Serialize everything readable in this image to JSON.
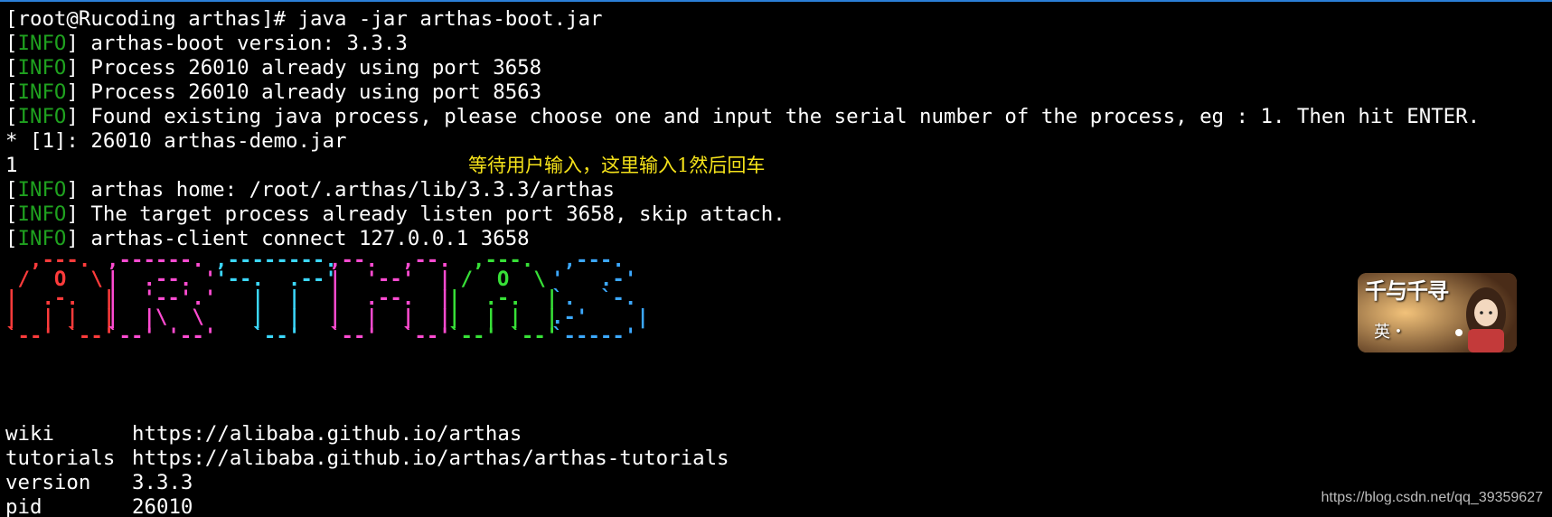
{
  "colors": {
    "background": "#000000",
    "text": "#ffffff",
    "info_level": "#1fa11f",
    "annotation": "#f5e21a",
    "title_border": "#2b7fd8"
  },
  "terminal": {
    "lines": [
      {
        "type": "plain",
        "text": "[root@Rucoding arthas]# java -jar arthas-boot.jar"
      },
      {
        "type": "log",
        "open": "[",
        "level": "INFO",
        "close": "]",
        "msg": " arthas-boot version: 3.3.3"
      },
      {
        "type": "log",
        "open": "[",
        "level": "INFO",
        "close": "]",
        "msg": " Process 26010 already using port 3658"
      },
      {
        "type": "log",
        "open": "[",
        "level": "INFO",
        "close": "]",
        "msg": " Process 26010 already using port 8563"
      },
      {
        "type": "log",
        "open": "[",
        "level": "INFO",
        "close": "]",
        "msg": " Found existing java process, please choose one and input the serial number of the process, eg : 1. Then hit ENTER."
      },
      {
        "type": "plain",
        "text": "* [1]: 26010 arthas-demo.jar"
      },
      {
        "type": "plain",
        "text": "1"
      },
      {
        "type": "log",
        "open": "[",
        "level": "INFO",
        "close": "]",
        "msg": " arthas home: /root/.arthas/lib/3.3.3/arthas"
      },
      {
        "type": "log",
        "open": "[",
        "level": "INFO",
        "close": "]",
        "msg": " The target process already listen port 3658, skip attach."
      },
      {
        "type": "log",
        "open": "[",
        "level": "INFO",
        "close": "]",
        "msg": " arthas-client connect 127.0.0.1 3658"
      }
    ],
    "annotation": "等待用户输入，这里输入1然后回车"
  },
  "banner": {
    "letters": [
      {
        "letter": "A",
        "color": "red",
        "rows": [
          "  ,---.  ",
          " /  O  \\ ",
          "|  .-.  |",
          "|  | |  |",
          "`--' `--'"
        ]
      },
      {
        "letter": "R",
        "color": "magenta",
        "rows": [
          ",------. ",
          "|  .--. '",
          "|  '--'.'",
          "|  |\\  \\ ",
          "`--' '--'"
        ]
      },
      {
        "letter": "T",
        "color": "cyan",
        "rows": [
          ",--------.",
          "'--.  .--'",
          "   |  |   ",
          "   |  |   ",
          "   `--'   "
        ]
      },
      {
        "letter": "H",
        "color": "pink",
        "rows": [
          ",--.  ,--.",
          "|  '--'  |",
          "|  .--.  |",
          "|  |  |  |",
          "`--'  `--'"
        ]
      },
      {
        "letter": "A",
        "color": "green",
        "rows": [
          "  ,---.  ",
          " /  O  \\ ",
          "|  .-.  |",
          "|  | |  |",
          "`--' `--'"
        ]
      },
      {
        "letter": "S",
        "color": "blue",
        "rows": [
          " ,---.  ",
          "'   .-' ",
          "`.  `-. ",
          ".-'    |",
          "`-----' "
        ]
      }
    ]
  },
  "logo": {
    "title": "千与千寻",
    "subtitle": "英・"
  },
  "info": [
    {
      "key": "wiki",
      "value": "https://alibaba.github.io/arthas"
    },
    {
      "key": "tutorials",
      "value": "https://alibaba.github.io/arthas/arthas-tutorials"
    },
    {
      "key": "version",
      "value": "3.3.3"
    },
    {
      "key": "pid",
      "value": "26010"
    }
  ],
  "watermark": "https://blog.csdn.net/qq_39359627"
}
